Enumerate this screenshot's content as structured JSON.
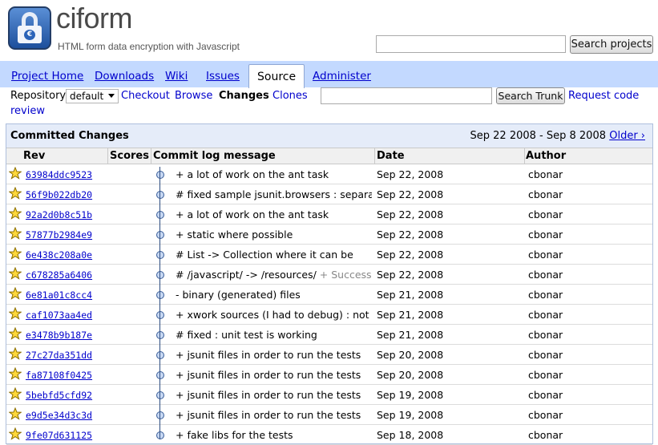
{
  "header": {
    "project_name": "ciform",
    "project_summary": "HTML form data encryption with Javascript",
    "search_button": "Search projects",
    "search_value": ""
  },
  "tabs": [
    {
      "label": "Project Home"
    },
    {
      "label": "Downloads"
    },
    {
      "label": "Wiki"
    },
    {
      "label": "Issues"
    },
    {
      "label": "Source",
      "active": true
    },
    {
      "label": "Administer"
    }
  ],
  "subnav": {
    "repository_label": "Repository:",
    "repository_value": "default",
    "checkout": "Checkout",
    "browse": "Browse",
    "changes": "Changes",
    "clones": "Clones",
    "search_button": "Search Trunk",
    "request_code": "Request code",
    "review": "review"
  },
  "panel": {
    "title": "Committed Changes",
    "range": "Sep 22 2008 - Sep 8 2008",
    "older": "Older ›",
    "columns": [
      "Rev",
      "Scores",
      "Commit log message",
      "Date",
      "Author"
    ]
  },
  "commits": [
    {
      "rev": "63984ddc9523",
      "msg": "+ a lot of work on the ant task",
      "extra": "",
      "date": "Sep 22, 2008",
      "author": "cbonar"
    },
    {
      "rev": "56f9b022db20",
      "msg": "# fixed sample jsunit.browsers : separa...",
      "extra": "",
      "date": "Sep 22, 2008",
      "author": "cbonar"
    },
    {
      "rev": "92a2d0b8c51b",
      "msg": "+ a lot of work on the ant task",
      "extra": "",
      "date": "Sep 22, 2008",
      "author": "cbonar"
    },
    {
      "rev": "57877b2984e9",
      "msg": "+ static where possible",
      "extra": "",
      "date": "Sep 22, 2008",
      "author": "cbonar"
    },
    {
      "rev": "6e438c208a0e",
      "msg": "# List -> Collection where it can be",
      "extra": "",
      "date": "Sep 22, 2008",
      "author": "cbonar"
    },
    {
      "rev": "c678285a6406",
      "msg": "# /javascript/ -> /resources/",
      "extra": " + Success...",
      "date": "Sep 22, 2008",
      "author": "cbonar"
    },
    {
      "rev": "6e81a01c8cc4",
      "msg": "- binary (generated) files",
      "extra": "",
      "date": "Sep 21, 2008",
      "author": "cbonar"
    },
    {
      "rev": "caf1073aa4ed",
      "msg": "+ xwork sources (I had to debug) : not r...",
      "extra": "",
      "date": "Sep 21, 2008",
      "author": "cbonar"
    },
    {
      "rev": "e3478b9b187e",
      "msg": "# fixed : unit test is working",
      "extra": "",
      "date": "Sep 21, 2008",
      "author": "cbonar"
    },
    {
      "rev": "27c27da351dd",
      "msg": "+ jsunit files in order to run the tests",
      "extra": "",
      "date": "Sep 20, 2008",
      "author": "cbonar"
    },
    {
      "rev": "fa87108f0425",
      "msg": "+ jsunit files in order to run the tests",
      "extra": "",
      "date": "Sep 20, 2008",
      "author": "cbonar"
    },
    {
      "rev": "5bebfd5cfd92",
      "msg": "+ jsunit files in order to run the tests",
      "extra": "",
      "date": "Sep 19, 2008",
      "author": "cbonar"
    },
    {
      "rev": "e9d5e34d3c3d",
      "msg": "+ jsunit files in order to run the tests",
      "extra": "",
      "date": "Sep 19, 2008",
      "author": "cbonar"
    },
    {
      "rev": "9fe07d631125",
      "msg": "+ fake libs for the tests",
      "extra": "",
      "date": "Sep 18, 2008",
      "author": "cbonar"
    }
  ]
}
